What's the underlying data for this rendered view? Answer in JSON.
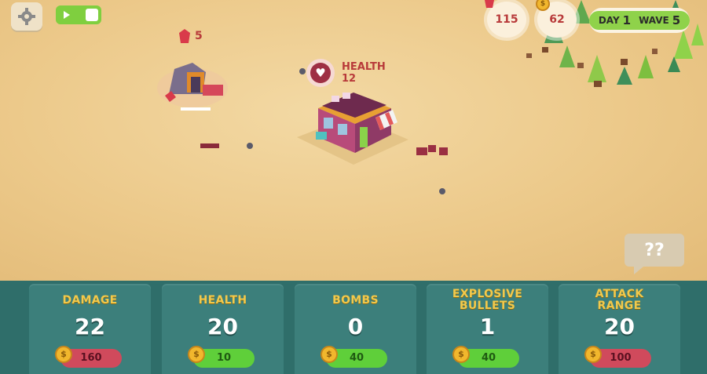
{
  "hud": {
    "gems": "115",
    "coins": "62",
    "day_label": "DAY",
    "day_value": "1",
    "wave_label": "WAVE",
    "wave_value": "5"
  },
  "mine": {
    "gem_count": "5"
  },
  "building": {
    "label": "HEALTH",
    "value": "12"
  },
  "help_text": "??",
  "upgrades": [
    {
      "title": "DAMAGE",
      "value": "22",
      "cost": "160",
      "affordable": false
    },
    {
      "title": "HEALTH",
      "value": "20",
      "cost": "10",
      "affordable": true
    },
    {
      "title": "BOMBS",
      "value": "0",
      "cost": "40",
      "affordable": true
    },
    {
      "title": "EXPLOSIVE BULLETS",
      "value": "1",
      "cost": "40",
      "affordable": true
    },
    {
      "title": "ATTACK RANGE",
      "value": "20",
      "cost": "100",
      "affordable": false
    }
  ],
  "colors": {
    "affordable": "#5fcf3a",
    "unaffordable": "#d04a5c",
    "panel": "#2f6e6a",
    "title_gold": "#f2c94c"
  },
  "icons": [
    "gear-icon",
    "play-icon",
    "gem-icon",
    "coin-icon",
    "heart-icon"
  ]
}
